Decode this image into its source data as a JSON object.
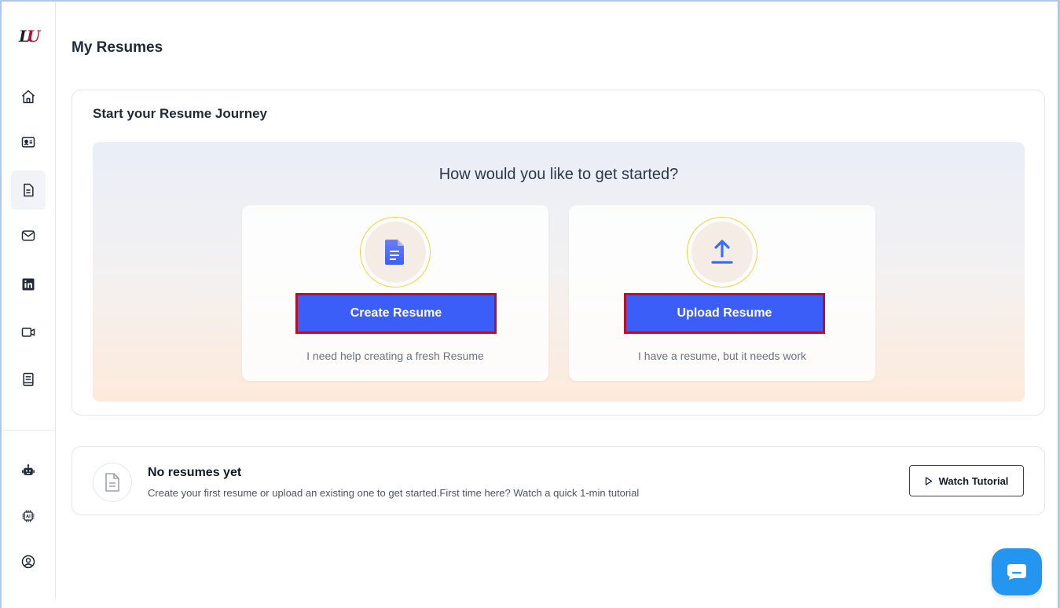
{
  "sidebar": {
    "logo_text": "LU",
    "items": [
      {
        "name": "home-icon",
        "active": false
      },
      {
        "name": "id-card-icon",
        "active": false
      },
      {
        "name": "document-icon",
        "active": true
      },
      {
        "name": "mail-icon",
        "active": false
      },
      {
        "name": "linkedin-icon",
        "active": false
      },
      {
        "name": "video-icon",
        "active": false
      },
      {
        "name": "notebook-icon",
        "active": false
      },
      {
        "name": "robot-icon",
        "active": false
      },
      {
        "name": "ai-chip-icon",
        "active": false
      },
      {
        "name": "user-circle-icon",
        "active": false
      }
    ]
  },
  "page": {
    "title": "My Resumes"
  },
  "journey": {
    "title": "Start your Resume Journey",
    "question": "How would you like to get started?",
    "create": {
      "icon": "document-icon",
      "button_label": "Create Resume",
      "description": "I need help creating a fresh Resume"
    },
    "upload": {
      "icon": "upload-icon",
      "button_label": "Upload Resume",
      "description": "I have a resume, but it needs work"
    }
  },
  "empty_state": {
    "icon": "file-icon",
    "title": "No resumes yet",
    "description": "Create your first resume or upload an existing one to get started.First time here? Watch a quick 1-min tutorial",
    "tutorial_button_label": "Watch Tutorial"
  },
  "chat": {
    "icon": "chat-icon"
  },
  "colors": {
    "primary": "#3a5ef7",
    "highlight_border": "#b3122b",
    "chat": "#2596f0",
    "accent_ring": "#f4d23c"
  }
}
